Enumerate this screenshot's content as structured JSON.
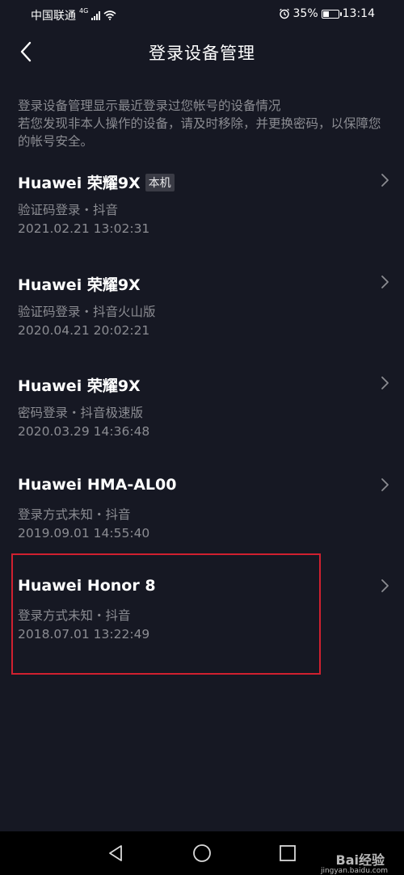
{
  "status_bar": {
    "carrier": "中国联通",
    "network": "4G",
    "battery": "35%",
    "battery_level": 0.35,
    "time": "13:14"
  },
  "header": {
    "title": "登录设备管理"
  },
  "description": {
    "line1": "登录设备管理显示最近登录过您帐号的设备情况",
    "line2": "若您发现非本人操作的设备，请及时移除，并更换密码，以保障您的帐号安全。"
  },
  "devices": [
    {
      "name": "Huawei 荣耀9X",
      "badge": "本机",
      "method": "验证码登录・抖音",
      "time": "2021.02.21 13:02:31"
    },
    {
      "name": "Huawei 荣耀9X",
      "method": "验证码登录・抖音火山版",
      "time": "2020.04.21 20:02:21"
    },
    {
      "name": "Huawei 荣耀9X",
      "method": "密码登录・抖音极速版",
      "time": "2020.03.29 14:36:48"
    },
    {
      "name": "Huawei HMA-AL00",
      "method": "登录方式未知・抖音",
      "time": "2019.09.01 14:55:40"
    },
    {
      "name": "Huawei Honor 8",
      "method": "登录方式未知・抖音",
      "time": "2018.07.01 13:22:49"
    }
  ],
  "watermark": {
    "text": "Bai经验",
    "sub": "jingyan.baidu.com"
  },
  "colors": {
    "background": "#161823",
    "secondary_text": "#8b8c92",
    "highlight": "#d0202f"
  }
}
